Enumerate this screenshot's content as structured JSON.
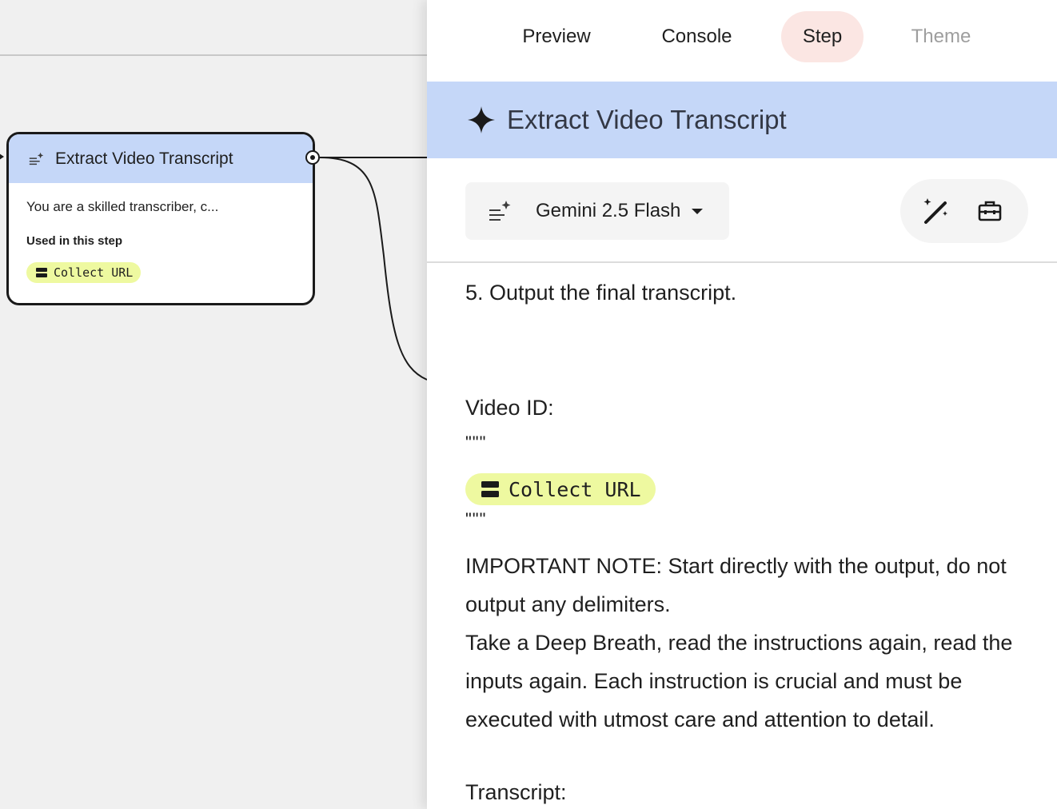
{
  "canvas": {
    "node": {
      "title": "Extract Video Transcript",
      "snippet": "You are a skilled transcriber, c...",
      "used_label": "Used in this step",
      "chip_label": "Collect URL"
    }
  },
  "tabs": [
    {
      "label": "Preview",
      "state": "normal"
    },
    {
      "label": "Console",
      "state": "normal"
    },
    {
      "label": "Step",
      "state": "active"
    },
    {
      "label": "Theme",
      "state": "disabled"
    }
  ],
  "step": {
    "title": "Extract Video Transcript",
    "model": "Gemini 2.5 Flash"
  },
  "prompt": {
    "line_5": "5.  Output the final transcript.",
    "video_label": "Video ID:",
    "quote_open": "\"\"\"",
    "chip_label": "Collect URL",
    "quote_close": "\"\"\"",
    "note": "IMPORTANT NOTE: Start directly with the output, do not output any delimiters.",
    "breath": "Take a Deep Breath, read the instructions again, read the inputs again. Each instruction is crucial and must be executed with utmost care and attention to detail.",
    "transcript_label": "Transcript:"
  },
  "colors": {
    "header_blue": "#c5d7f8",
    "chip_yellow": "#eef9a0",
    "active_tab": "#fbe6e3"
  }
}
